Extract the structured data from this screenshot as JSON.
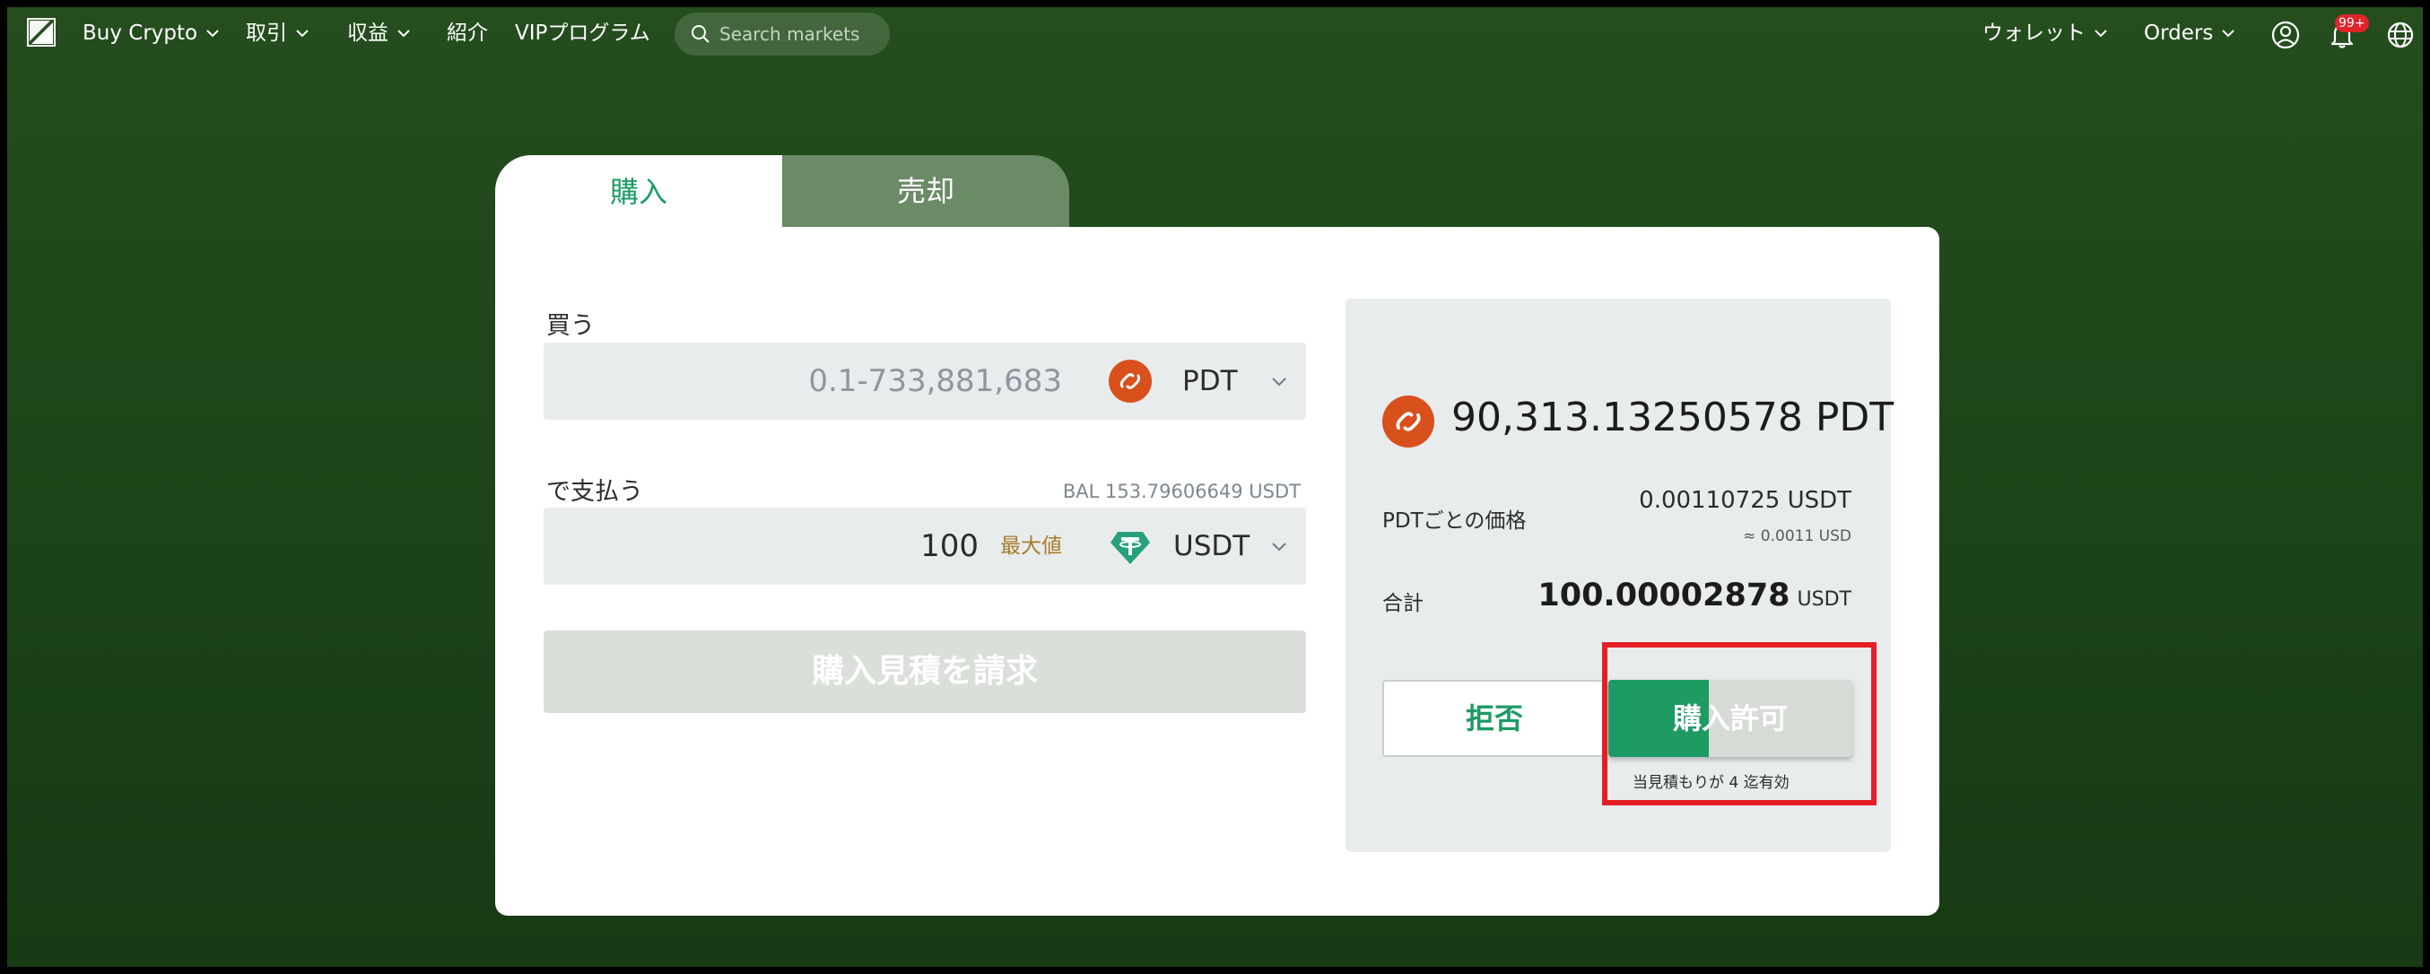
{
  "nav": {
    "items": [
      {
        "label": "Buy Crypto",
        "has_chevron": true
      },
      {
        "label": "取引",
        "has_chevron": true
      },
      {
        "label": "収益",
        "has_chevron": true
      },
      {
        "label": "紹介",
        "has_chevron": false
      },
      {
        "label": "VIPプログラム",
        "has_chevron": false
      }
    ],
    "search_placeholder": "Search markets",
    "right_items": [
      {
        "label": "ウォレット",
        "has_chevron": true
      },
      {
        "label": "Orders",
        "has_chevron": true
      }
    ],
    "notification_badge": "99+",
    "icons": [
      "logo-icon",
      "search-icon",
      "user-icon",
      "bell-icon",
      "globe-icon"
    ]
  },
  "tabs": {
    "buy": "購入",
    "sell": "売却",
    "active": "buy"
  },
  "form": {
    "buy_label": "買う",
    "buy_placeholder": "0.1-733,881,683",
    "buy_coin": "PDT",
    "pay_label": "で支払う",
    "balance": "BAL 153.79606649 USDT",
    "pay_value": "100",
    "max_label": "最大値",
    "pay_coin": "USDT",
    "request_button": "購入見積を請求"
  },
  "quote": {
    "amount": "90,313.13250578 PDT",
    "price_label": "PDTごとの価格",
    "price_value": "0.00110725 USDT",
    "price_usd": "≈ 0.0011 USD",
    "total_label": "合計",
    "total_value": "100.00002878",
    "total_unit": "USDT",
    "reject_button": "拒否",
    "accept_button": "購入許可",
    "accept_progress_fraction": 0.41,
    "valid_note": "当見積もりが 4 迄有効"
  },
  "colors": {
    "accent": "#1d9b63",
    "background": "#1e4519",
    "highlight": "#e51e26",
    "pdt_coin": "#d8501c",
    "usdt_coin": "#26a17b"
  }
}
